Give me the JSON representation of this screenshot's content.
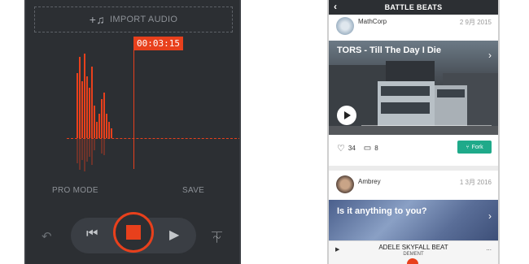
{
  "left_app": {
    "import_label": "IMPORT AUDIO",
    "timer": "00:03:15",
    "pro_mode_label": "PRO MODE",
    "save_label": "SAVE",
    "accent": "#e8401c",
    "icons": {
      "import": "music-plus-icon",
      "undo": "undo-icon",
      "prev": "skip-back-icon",
      "record": "stop-icon",
      "next": "play-icon",
      "metronome": "metronome-icon"
    }
  },
  "right_app": {
    "title": "BATTLE BEATS",
    "posts": [
      {
        "user": "MathCorp",
        "date": "2 9月 2015",
        "track": "TORS - Till The Day I Die",
        "likes": "34",
        "comments": "8",
        "fork_label": "Fork"
      },
      {
        "user": "Ambrey",
        "date": "1 3月 2016",
        "track": "Is it anything to you?"
      }
    ],
    "player": {
      "title": "ADELE SKYFALL BEAT",
      "artist": "DEMENT",
      "more": "..."
    },
    "fork_color": "#1faa8a"
  }
}
